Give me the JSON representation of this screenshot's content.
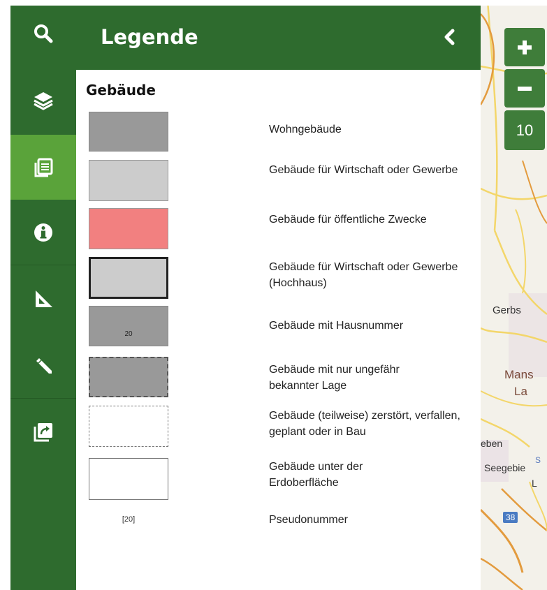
{
  "panel": {
    "title": "Legende",
    "collapse_icon": "chevron-left-icon"
  },
  "rail": {
    "items": [
      {
        "icon": "search-icon",
        "active": false
      },
      {
        "icon": "layers-icon",
        "active": false
      },
      {
        "icon": "legend-icon",
        "active": true
      },
      {
        "icon": "info-icon",
        "active": false
      },
      {
        "icon": "measure-icon",
        "active": false
      },
      {
        "icon": "draw-icon",
        "active": false
      },
      {
        "icon": "share-icon",
        "active": false
      }
    ]
  },
  "legend": {
    "section_title": "Gebäude",
    "items": [
      {
        "label": "Wohngebäude",
        "fill": "#999999",
        "border": "#888888",
        "style": "solid"
      },
      {
        "label": "Gebäude für Wirtschaft oder Gewerbe",
        "fill": "#cccccc",
        "border": "#999999",
        "style": "solid"
      },
      {
        "label": "Gebäude für öffentliche Zwecke",
        "fill": "#f28080",
        "border": "#999999",
        "style": "solid"
      },
      {
        "label": "Gebäude für Wirtschaft oder Gewerbe (Hochhaus)",
        "fill": "#cccccc",
        "border": "#222222",
        "style": "thick"
      },
      {
        "label": "Gebäude mit Hausnummer",
        "fill": "#999999",
        "border": "#888888",
        "style": "solid",
        "number": "20"
      },
      {
        "label": "Gebäude mit nur ungefähr bekannter Lage",
        "fill": "#999999",
        "border": "#555555",
        "style": "dashed"
      },
      {
        "label": "Gebäude (teilweise) zerstört, verfallen, geplant oder in Bau",
        "fill": "#ffffff",
        "border": "#777777",
        "style": "dashed"
      },
      {
        "label": "Gebäude unter der Erdoberfläche",
        "fill": "#ffffff",
        "border": "#777777",
        "style": "solid"
      },
      {
        "label": "Pseudonummer",
        "pseudo": "[20]"
      }
    ]
  },
  "map": {
    "zoom_in_icon": "plus-icon",
    "zoom_out_icon": "minus-icon",
    "zoom_level": "10",
    "labels": [
      "Gerbs",
      "Mans",
      "La",
      "eben",
      "S",
      "Seegebie",
      "L",
      "38"
    ]
  },
  "colors": {
    "rail": "#2e6b2e",
    "rail_active": "#5aa33a",
    "header": "#2e6b2e",
    "zoom_button": "#3f7d3a"
  }
}
